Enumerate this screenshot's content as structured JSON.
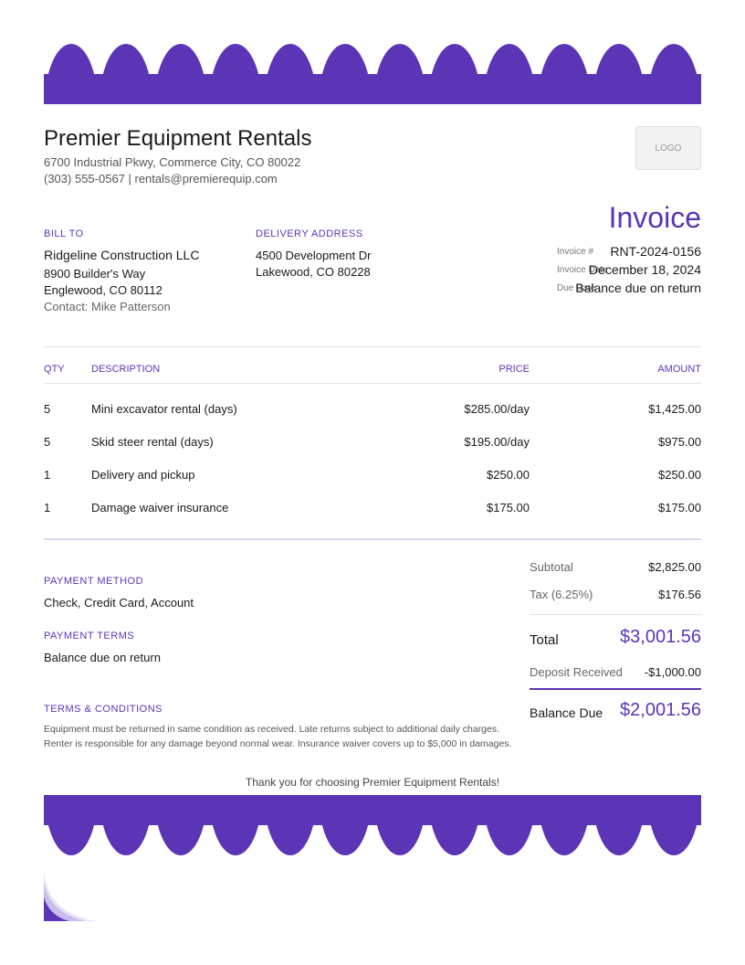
{
  "company": {
    "name": "Premier Equipment Rentals",
    "address": "6700 Industrial Pkwy, Commerce City, CO 80022",
    "contact": "(303) 555-0567 | rentals@premierequip.com",
    "logo_text": "LOGO"
  },
  "bill_to": {
    "label": "BILL TO",
    "name": "Ridgeline Construction LLC",
    "street": "8900 Builder's Way",
    "city": "Englewood, CO 80112",
    "contact": "Contact: Mike Patterson"
  },
  "delivery": {
    "label": "DELIVERY ADDRESS",
    "street": "4500 Development Dr",
    "city": "Lakewood, CO 80228"
  },
  "invoice": {
    "title": "Invoice",
    "number_label": "Invoice #",
    "number": "RNT-2024-0156",
    "date_label": "Invoice Date",
    "date": "December 18, 2024",
    "due_label": "Due Date",
    "due": "Balance due on return"
  },
  "table": {
    "headers": {
      "qty": "QTY",
      "description": "DESCRIPTION",
      "price": "PRICE",
      "amount": "AMOUNT"
    },
    "rows": [
      {
        "qty": "5",
        "description": "Mini excavator rental (days)",
        "price": "$285.00/day",
        "amount": "$1,425.00"
      },
      {
        "qty": "5",
        "description": "Skid steer rental (days)",
        "price": "$195.00/day",
        "amount": "$975.00"
      },
      {
        "qty": "1",
        "description": "Delivery and pickup",
        "price": "$250.00",
        "amount": "$250.00"
      },
      {
        "qty": "1",
        "description": "Damage waiver insurance",
        "price": "$175.00",
        "amount": "$175.00"
      }
    ]
  },
  "payment": {
    "method_label": "PAYMENT METHOD",
    "method": "Check, Credit Card, Account",
    "terms_label": "PAYMENT TERMS",
    "terms": "Balance due on return"
  },
  "totals": {
    "subtotal_label": "Subtotal",
    "subtotal": "$2,825.00",
    "tax_label": "Tax (6.25%)",
    "tax": "$176.56",
    "total_label": "Total",
    "total": "$3,001.56",
    "deposit_label": "Deposit Received",
    "deposit": "-$1,000.00",
    "balance_label": "Balance Due",
    "balance": "$2,001.56"
  },
  "terms_conditions": {
    "label": "TERMS & CONDITIONS",
    "line1": "Equipment must be returned in same condition as received. Late returns subject to additional daily charges.",
    "line2": "Renter is responsible for any damage beyond normal wear. Insurance waiver covers up to $5,000 in damages."
  },
  "footer": {
    "thanks": "Thank you for choosing Premier Equipment Rentals!"
  },
  "colors": {
    "accent": "#5b35b5",
    "lavender_rule": "#ddd6ef"
  }
}
